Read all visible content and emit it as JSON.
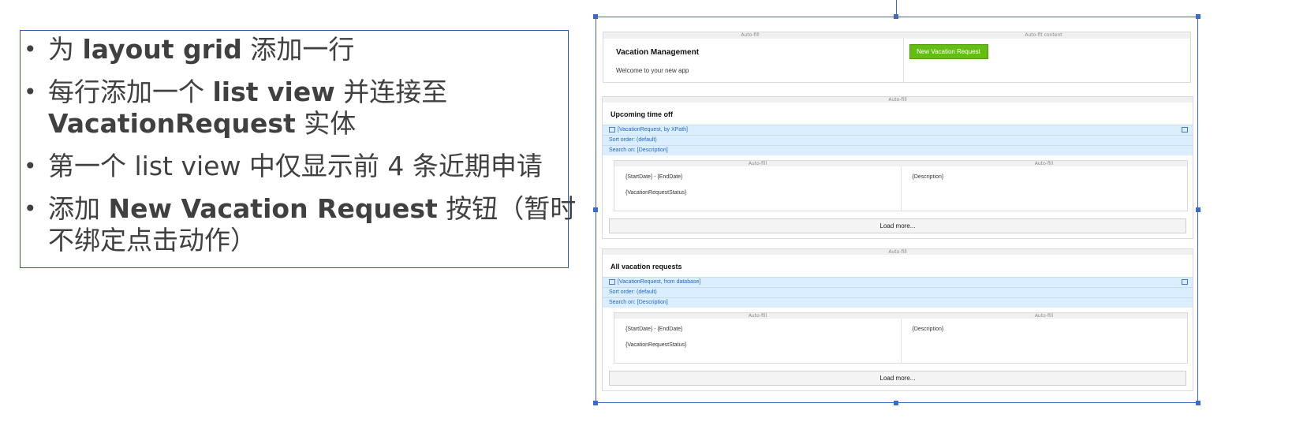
{
  "bullets": [
    {
      "pre": "为 ",
      "bold": "layout grid",
      "post": " 添加一行"
    },
    {
      "pre": "每行添加一个 ",
      "bold": "list view",
      "post": " 并连接至"
    },
    {
      "pre": "",
      "bold": "VacationRequest",
      "post": " 实体"
    },
    {
      "pre": "第一个 list view 中仅显示前 4 条近期申请",
      "bold": "",
      "post": ""
    },
    {
      "pre": "添加 ",
      "bold": "New Vacation Request",
      "post": " 按钮（暂时"
    },
    {
      "pre": "不绑定点击动作）",
      "bold": "",
      "post": ""
    }
  ],
  "editor": {
    "header": {
      "autofill_left": "Auto-fill",
      "autofill_right": "Auto-fit content",
      "title": "Vacation Management",
      "welcome": "Welcome to your new app",
      "new_button": "New Vacation Request"
    },
    "section_autofill": "Auto-fill",
    "upcoming": {
      "title": "Upcoming time off",
      "datasource": "[VacationRequest, by XPath]",
      "sort": "Sort order: (default)",
      "search": "Search on: [Description]",
      "col_left_autofill": "Auto-fill",
      "col_right_autofill": "Auto-fill",
      "dates": "{StartDate} - {EndDate}",
      "status": "{VacationRequestStatus}",
      "description": "{Description}",
      "load_more": "Load more..."
    },
    "all": {
      "title": "All vacation requests",
      "datasource": "[VacationRequest, from database]",
      "sort": "Sort order: (default)",
      "search": "Search on: [Description]",
      "col_left_autofill": "Auto-fill",
      "col_right_autofill": "Auto-fill",
      "dates": "{StartDate} - {EndDate}",
      "status": "{VacationRequestStatus}",
      "description": "{Description}",
      "load_more": "Load more..."
    }
  },
  "colors": {
    "accent_blue": "#3b6bc8",
    "button_green": "#64bd12",
    "datasource_bg": "#dbeeff"
  }
}
